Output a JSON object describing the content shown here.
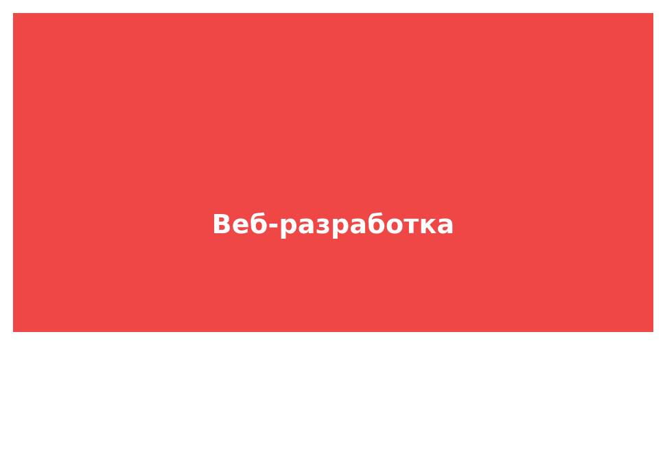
{
  "banner": {
    "title": "Веб-разработка",
    "background_color": "#ef4646",
    "text_color": "#ffffff"
  }
}
